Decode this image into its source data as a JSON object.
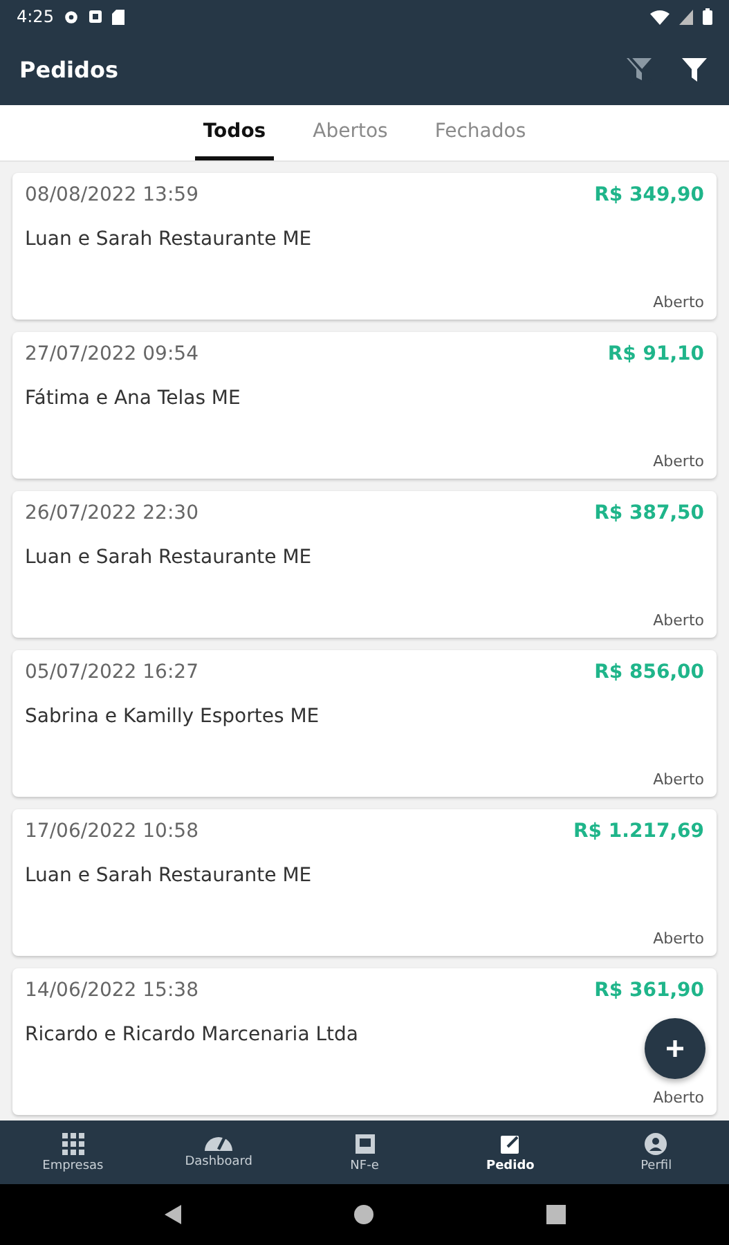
{
  "status_bar": {
    "time": "4:25"
  },
  "app_bar": {
    "title": "Pedidos"
  },
  "tabs": [
    {
      "label": "Todos",
      "selected": true
    },
    {
      "label": "Abertos",
      "selected": false
    },
    {
      "label": "Fechados",
      "selected": false
    }
  ],
  "orders": [
    {
      "date": "08/08/2022 13:59",
      "total": "R$ 349,90",
      "customer": "Luan e Sarah Restaurante ME",
      "status": "Aberto"
    },
    {
      "date": "27/07/2022 09:54",
      "total": "R$ 91,10",
      "customer": "Fátima e Ana Telas ME",
      "status": "Aberto"
    },
    {
      "date": "26/07/2022 22:30",
      "total": "R$ 387,50",
      "customer": "Luan e Sarah Restaurante ME",
      "status": "Aberto"
    },
    {
      "date": "05/07/2022 16:27",
      "total": "R$ 856,00",
      "customer": "Sabrina e Kamilly Esportes ME",
      "status": "Aberto"
    },
    {
      "date": "17/06/2022 10:58",
      "total": "R$ 1.217,69",
      "customer": "Luan e Sarah Restaurante ME",
      "status": "Aberto"
    },
    {
      "date": "14/06/2022 15:38",
      "total": "R$ 361,90",
      "customer": "Ricardo e Ricardo Marcenaria Ltda",
      "status": "Aberto"
    }
  ],
  "bottom_nav": [
    {
      "label": "Empresas",
      "kind": "grid",
      "selected": false
    },
    {
      "label": "Dashboard",
      "kind": "gauge",
      "selected": false
    },
    {
      "label": "NF-e",
      "kind": "doc",
      "selected": false
    },
    {
      "label": "Pedido",
      "kind": "edit",
      "selected": true
    },
    {
      "label": "Perfil",
      "kind": "person",
      "selected": false
    }
  ]
}
